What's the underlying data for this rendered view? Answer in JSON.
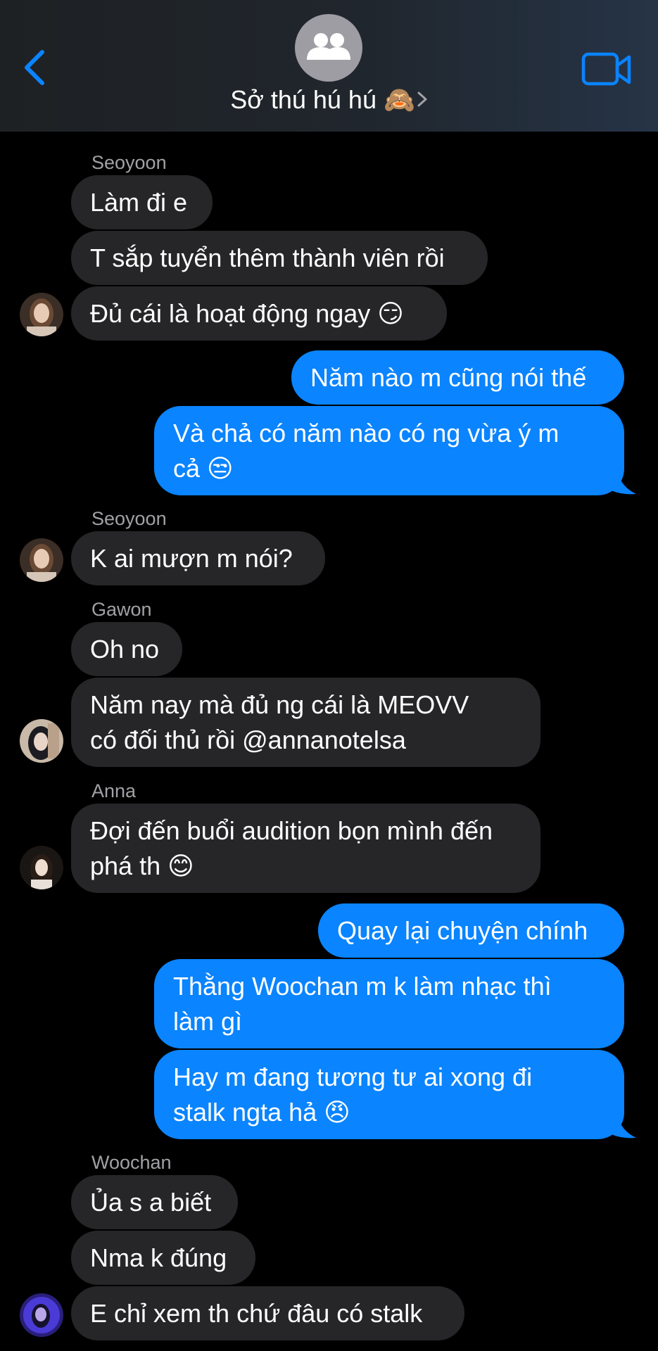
{
  "header": {
    "title": "Sở thú hú hú 🙈",
    "back_icon": "chevron-left-icon",
    "group_icon": "group-people-icon",
    "video_icon": "video-camera-icon",
    "accent_color": "#0a84ff"
  },
  "messages": [
    {
      "sender": "Seoyoon"
    },
    {
      "text": "Làm đi e"
    },
    {
      "text": "T sắp tuyển thêm thành viên rồi"
    },
    {
      "text": "Đủ cái là hoạt động ngay 😏"
    },
    {
      "text": "Năm nào m cũng nói thế"
    },
    {
      "text": "Và chả có năm nào có ng vừa ý m\ncả 😒"
    },
    {
      "sender": "Seoyoon"
    },
    {
      "text": "K ai mượn m nói?"
    },
    {
      "sender": "Gawon"
    },
    {
      "text": "Oh no"
    },
    {
      "text": "Năm nay mà đủ ng cái là MEOVV\ncó đối thủ rồi @annanotelsa"
    },
    {
      "sender": "Anna"
    },
    {
      "text": "Đợi đến buổi audition bọn mình đến\nphá th 😊"
    },
    {
      "text": "Quay lại chuyện chính"
    },
    {
      "text": "Thằng Woochan m k làm nhạc thì\nlàm gì"
    },
    {
      "text": "Hay m đang tương tư ai xong đi\nstalk ngta hả 😠"
    },
    {
      "sender": "Woochan"
    },
    {
      "text": "Ủa s a biết"
    },
    {
      "text": "Nma k đúng"
    },
    {
      "text": "E chỉ xem th chứ đâu có stalk"
    }
  ],
  "colors": {
    "incoming_bubble": "#262628",
    "outgoing_bubble": "#0a84ff",
    "background": "#000000",
    "sender_name": "#a1a1a6"
  }
}
